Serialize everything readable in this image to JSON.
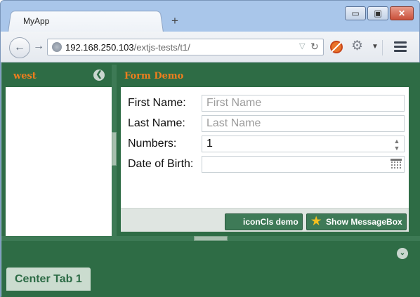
{
  "browser": {
    "tab_title": "MyApp",
    "new_tab_symbol": "+",
    "url_host": "192.168.250.103",
    "url_path": "/extjs-tests/t1/",
    "window_controls": {
      "minimize": "▭",
      "maximize": "▣",
      "close": "✕"
    },
    "icons": [
      "back-icon",
      "forward-icon",
      "globe-icon",
      "dropdown-icon",
      "reload-icon",
      "noscript-icon",
      "gear-icon",
      "menu-icon"
    ]
  },
  "west": {
    "title": "west",
    "collapse_glyph": "❮"
  },
  "form": {
    "title": "Form Demo",
    "fields": {
      "first_name": {
        "label": "First Name:",
        "placeholder": "First Name",
        "value": ""
      },
      "last_name": {
        "label": "Last Name:",
        "placeholder": "Last Name",
        "value": ""
      },
      "numbers": {
        "label": "Numbers:",
        "value": "1"
      },
      "dob": {
        "label": "Date of Birth:",
        "value": ""
      }
    },
    "buttons": {
      "iconcls": "iconCls demo",
      "msgbox": "Show MessageBox"
    }
  },
  "south": {
    "expand_glyph": "⌄",
    "tab_label": "Center Tab 1"
  },
  "colors": {
    "panel_green": "#2e6c45",
    "title_orange": "#f07e1d",
    "tab_green": "#cbdccf"
  }
}
